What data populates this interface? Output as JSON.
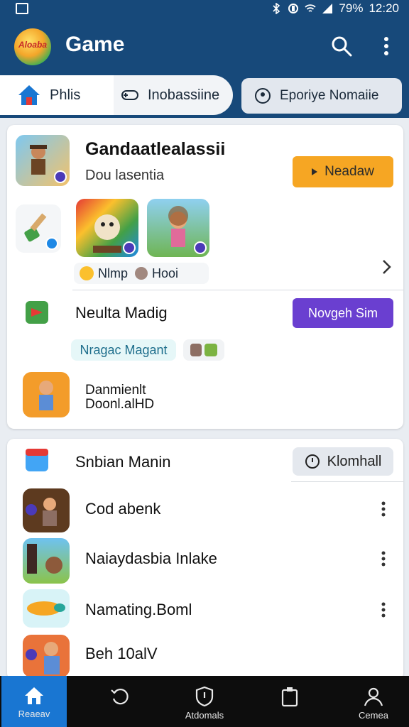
{
  "status_bar": {
    "battery": "79%",
    "time": "12:20"
  },
  "app_bar": {
    "logo_text": "Aloaba",
    "title": "Game"
  },
  "tabs": [
    {
      "label": "Phlis"
    },
    {
      "label": "Inobassiine"
    },
    {
      "label": "Eporiye Nomaiie"
    }
  ],
  "card1": {
    "title": "Gandaatlealassii",
    "subtitle": "Dou lasentia",
    "action_label": "Neadaw",
    "tags": [
      "Nlmp",
      "Hooi"
    ],
    "section_title": "Neulta Madig",
    "section_button": "Novgeh Sim",
    "pill_label": "Nragac Magant",
    "item_line1": "Danmienlt",
    "item_line2": "Doonl.alHD"
  },
  "card2": {
    "title": "Snbian Manin",
    "button_label": "Klomhall",
    "rows": [
      {
        "label": "Cod abenk"
      },
      {
        "label": "Naiaydasbia Inlake"
      },
      {
        "label": "Namating.Boml"
      },
      {
        "label": "Beh 10alV"
      }
    ]
  },
  "bottom_nav": [
    {
      "label": "Reaeav"
    },
    {
      "label": ""
    },
    {
      "label": "Atdomals"
    },
    {
      "label": ""
    },
    {
      "label": "Cemea"
    }
  ],
  "colors": {
    "primary": "#17497a",
    "accent_orange": "#f6a623",
    "accent_purple": "#6a3fd0",
    "nav_active": "#1976d2"
  }
}
